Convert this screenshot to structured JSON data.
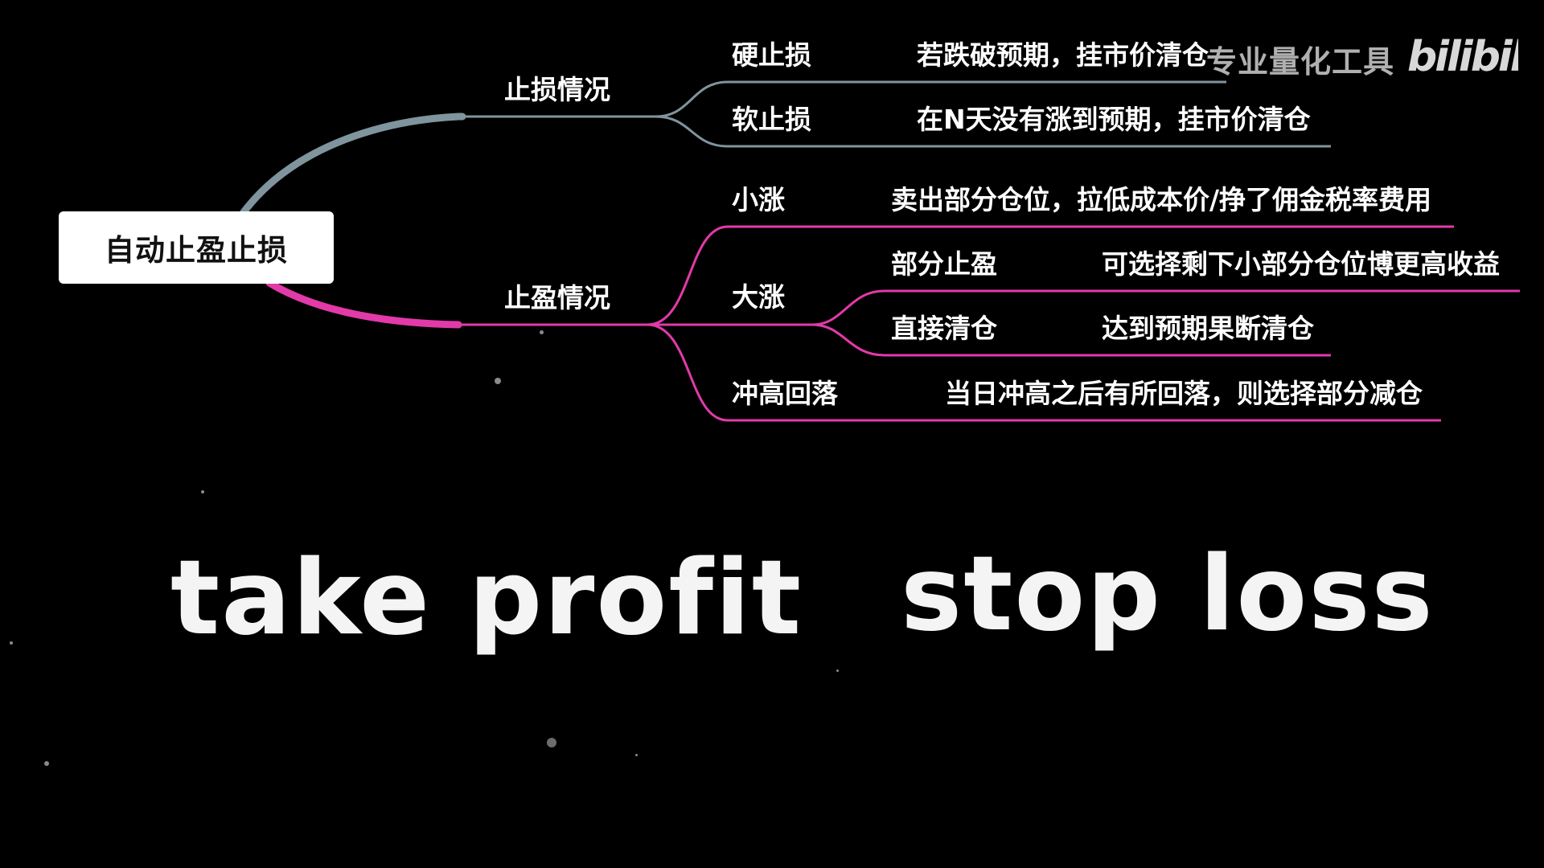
{
  "root": {
    "label": "自动止盈止损"
  },
  "branches": {
    "stop_loss": {
      "label": "止损情况",
      "color": "#7f949c",
      "items": [
        {
          "label": "硬止损",
          "desc": "若跌破预期，挂市价清仓"
        },
        {
          "label": "软止损",
          "desc": "在N天没有涨到预期，挂市价清仓"
        }
      ]
    },
    "take_profit": {
      "label": "止盈情况",
      "color": "#e23aa8",
      "small_rise": {
        "label": "小涨",
        "desc": "卖出部分仓位，拉低成本价/挣了佣金税率费用"
      },
      "big_rise": {
        "label": "大涨",
        "children": [
          {
            "label": "部分止盈",
            "desc": "可选择剩下小部分仓位博更高收益"
          },
          {
            "label": "直接清仓",
            "desc": "达到预期果断清仓"
          }
        ]
      },
      "spike_fall": {
        "label": "冲高回落",
        "desc": "当日冲高之后有所回落，则选择部分减仓"
      }
    }
  },
  "watermark": {
    "text": "专业量化工具",
    "logo": "bilibili"
  },
  "big_words": {
    "left": "take profit",
    "right": "stop loss"
  },
  "colors": {
    "background": "#000000",
    "text": "#ffffff",
    "gray_branch": "#7f949c",
    "pink_branch": "#e23aa8"
  }
}
